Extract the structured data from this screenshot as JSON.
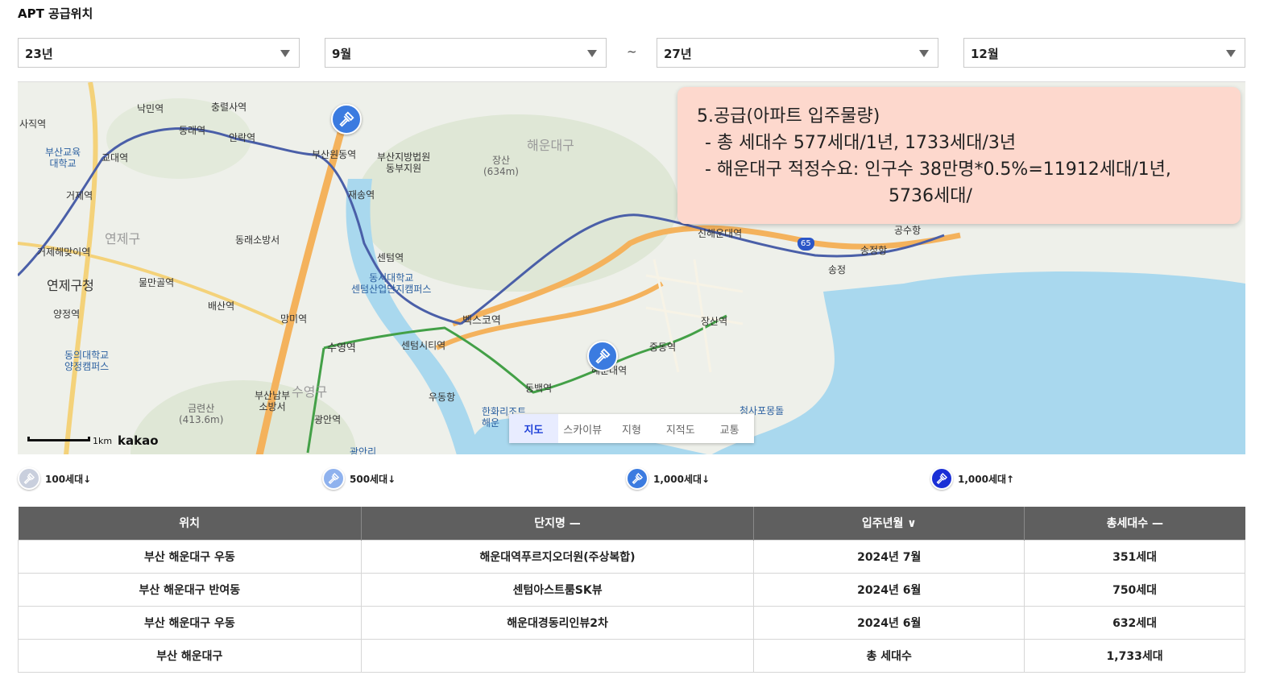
{
  "header": {
    "title": "APT 공급위치"
  },
  "filters": {
    "start_year": "23년",
    "start_month": "9월",
    "separator": "~",
    "end_year": "27년",
    "end_month": "12월"
  },
  "map": {
    "labels": {
      "nakmin": "낙민역",
      "chungnyeol": "충렬사역",
      "sajik": "사직역",
      "dongnae": "동래역",
      "anrak": "안락역",
      "busan_edu_univ": "부산교육\n대학교",
      "gyodae": "교대역",
      "busanwon": "부산원동역",
      "court": "부산지방법원\n동부지원",
      "jangsan_mt": "장산\n(634m)",
      "haeundae_gu_label": "해운대구",
      "geoje": "거제역",
      "jaesong": "재송역",
      "yeonje_gu_label": "연제구",
      "fire_station": "동래소방서",
      "geoje_haemaji": "거제해맞이역",
      "centum": "센텀역",
      "dongseo_univ": "동서대학교\n센텀산업단지캠퍼스",
      "yeonje_office": "연제구청",
      "mulmangol": "물만골역",
      "yangjeong": "양정역",
      "baesan": "배산역",
      "mangmi": "망미역",
      "bexco": "벡스코역",
      "dongeui_univ": "동의대학교\n양정캠퍼스",
      "suyeong": "수영역",
      "centum_city": "센텀시티역",
      "new_haeundae": "신해운대역",
      "songjeong_port": "송정항",
      "songjeong": "송정",
      "gongsu": "공수항",
      "jangsan_st": "장산역",
      "jungdong": "중동역",
      "haeundae_st": "해운대역",
      "geumryeonsan": "금련산\n(413.6m)",
      "namgu_fire": "부산남부\n소방서",
      "suyeong_gu_label": "수영구",
      "uddong_port": "우동항",
      "dongbaek": "동백역",
      "gwangan": "광안역",
      "cheongsapo": "청사포몽돌",
      "hanwha": "한화리조트\n해운",
      "gwangalli": "광안리",
      "highway": "65",
      "scale": "1km",
      "brand": "kakao"
    },
    "tabs": [
      "지도",
      "스카이뷰",
      "지형",
      "지적도",
      "교통"
    ],
    "active_tab": "지도",
    "water_color": "#a9d8ee",
    "road_color": "#f4b25c"
  },
  "callout": {
    "line1": "5.공급(아파트 입주물량)",
    "line2": "- 총 세대수 577세대/1년, 1733세대/3년",
    "line3": "- 해운대구 적정수요: 인구수 38만명*0.5%=11912세대/1년,",
    "line4": "5736세대/"
  },
  "legend": [
    {
      "label": "100세대↓",
      "color": "#c9cfdd",
      "icon": "gavel-icon"
    },
    {
      "label": "500세대↓",
      "color": "#8fb2ee",
      "icon": "gavel-icon"
    },
    {
      "label": "1,000세대↓",
      "color": "#3b7be0",
      "icon": "gavel-icon"
    },
    {
      "label": "1,000세대↑",
      "color": "#1a2fd6",
      "icon": "gavel-icon"
    }
  ],
  "table": {
    "headers": [
      "위치",
      "단지명 —",
      "입주년월 ∨",
      "총세대수 —"
    ],
    "rows": [
      [
        "부산 해운대구 우동",
        "해운대역푸르지오더원(주상복합)",
        "2024년 7월",
        "351세대"
      ],
      [
        "부산 해운대구 반여동",
        "센텀아스트룸SK뷰",
        "2024년 6월",
        "750세대"
      ],
      [
        "부산 해운대구 우동",
        "해운대경동리인뷰2차",
        "2024년 6월",
        "632세대"
      ],
      [
        "부산 해운대구",
        "",
        "총 세대수",
        "1,733세대"
      ]
    ]
  }
}
